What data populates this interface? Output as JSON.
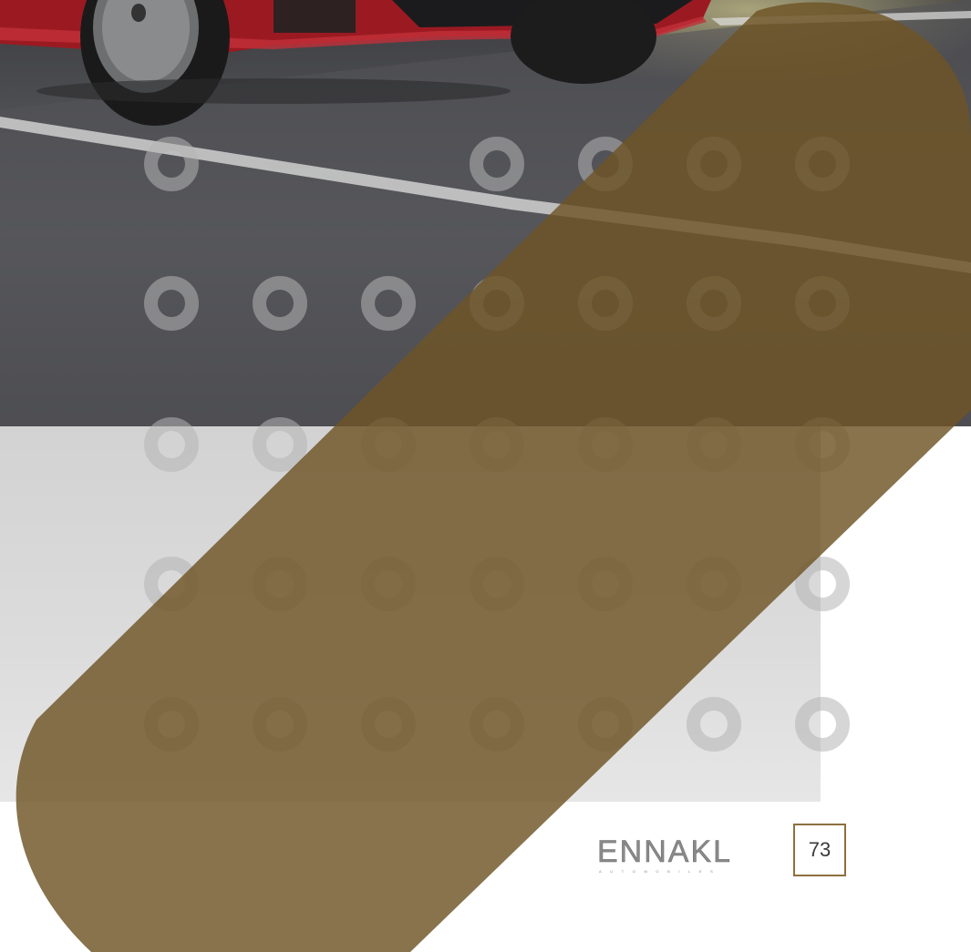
{
  "brand": {
    "logo_text": "ENNAKL",
    "logo_subtext": "AUTOMOBILES"
  },
  "page": {
    "number": "73"
  },
  "colors": {
    "accent": "#8d6f3f",
    "stripe": "#7a5f30",
    "dot": "#b4b4b4",
    "grey_band": "#d8d8d8"
  },
  "photo": {
    "subject": "red car on road"
  }
}
